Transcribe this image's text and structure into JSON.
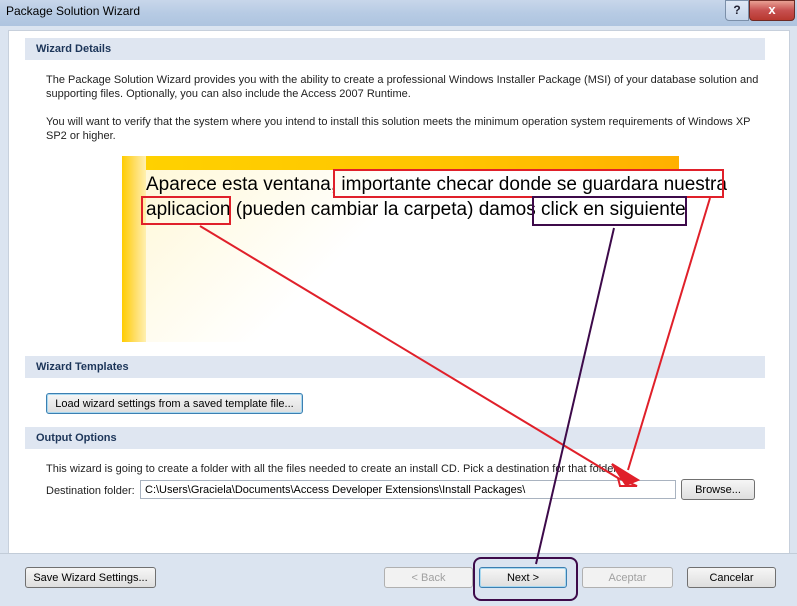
{
  "window": {
    "title": "Package Solution Wizard",
    "help_glyph": "?",
    "close_glyph": "x"
  },
  "wizard_details": {
    "header": "Wizard Details",
    "paragraph1_line1": "The Package Solution Wizard provides you with the ability to create a professional Windows Installer Package (MSI) of your database solution and",
    "paragraph1_line2": "supporting files. Optionally, you can also include the Access 2007 Runtime.",
    "paragraph2_line1": "You will want to verify that the system where you intend to install this solution meets the minimum operation system requirements of Windows XP",
    "paragraph2_line2": "SP2 or higher."
  },
  "annotation": {
    "line1_part1": "Aparece esta ventana, ",
    "line1_part2": "importante checar donde se guardara nuestra",
    "line2_part1": "aplicacion",
    "line2_part2": " (pueden cambiar la carpeta) damos ",
    "line2_part3": "click en siguiente"
  },
  "wizard_templates": {
    "header": "Wizard Templates",
    "load_button": "Load wizard settings from a saved template file..."
  },
  "output_options": {
    "header": "Output Options",
    "description": "This wizard is going to create a folder with all the files needed to create an install CD.  Pick a destination for that folder.",
    "destination_label": "Destination folder:",
    "destination_value": "C:\\Users\\Graciela\\Documents\\Access Developer Extensions\\Install Packages\\",
    "browse_button": "Browse..."
  },
  "footer": {
    "save_button": "Save Wizard Settings...",
    "back_button": "< Back",
    "next_button": "Next >",
    "accept_button": "Aceptar",
    "cancel_button": "Cancelar"
  },
  "colors": {
    "annotation_red": "#e0202a",
    "annotation_purple": "#3d0a4a",
    "banner_yellow": "#ffcc00"
  }
}
